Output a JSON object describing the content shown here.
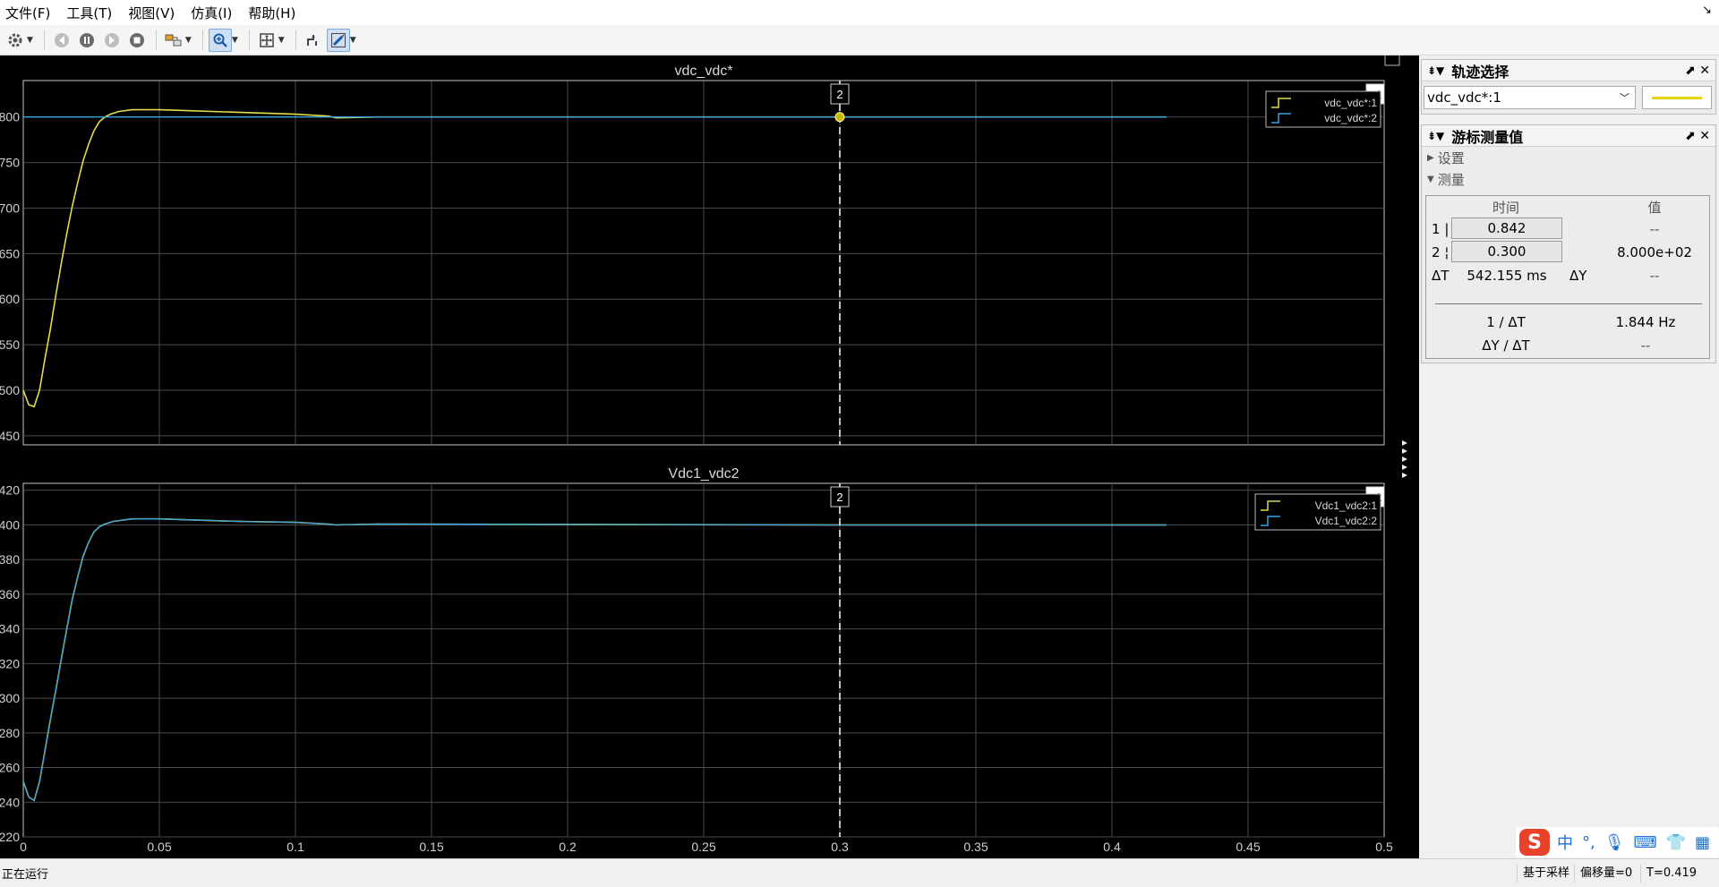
{
  "menu": [
    "文件(F)",
    "工具(T)",
    "视图(V)",
    "仿真(I)",
    "帮助(H)"
  ],
  "window_corner_icon": "↘",
  "plots": [
    {
      "title": "vdc_vdc*",
      "legend": [
        "vdc_vdc*:1",
        "vdc_vdc*:2"
      ],
      "yticks": [
        "800",
        "750",
        "700",
        "650",
        "600",
        "550",
        "500",
        "450"
      ],
      "cursor_tag": "2",
      "corner_tag": "1"
    },
    {
      "title": "Vdc1_vdc2",
      "legend": [
        "Vdc1_vdc2:1",
        "Vdc1_vdc2:2"
      ],
      "yticks": [
        "420",
        "400",
        "380",
        "360",
        "340",
        "320",
        "300",
        "280",
        "260",
        "240",
        "220"
      ],
      "cursor_tag": "2",
      "corner_tag": "1"
    }
  ],
  "xticks": [
    "0",
    "0.05",
    "0.1",
    "0.15",
    "0.2",
    "0.25",
    "0.3",
    "0.35",
    "0.4",
    "0.45",
    "0.5"
  ],
  "colors": {
    "series1": "#e3dc4a",
    "series2": "#3aa0e0",
    "grid": "#4a4a4a",
    "axis": "#c8c8c8",
    "cursor": "#ffffff"
  },
  "chart_data": [
    {
      "type": "line",
      "title": "vdc_vdc*",
      "xlim": [
        0,
        0.5
      ],
      "ylim": [
        440,
        840
      ],
      "series": [
        {
          "name": "vdc_vdc*:1",
          "color": "#e3dc4a",
          "x": [
            0,
            0.002,
            0.004,
            0.006,
            0.008,
            0.01,
            0.012,
            0.014,
            0.016,
            0.018,
            0.02,
            0.022,
            0.024,
            0.026,
            0.028,
            0.03,
            0.032,
            0.035,
            0.04,
            0.05,
            0.06,
            0.08,
            0.1,
            0.112,
            0.115,
            0.13,
            0.2,
            0.3,
            0.42
          ],
          "y": [
            500,
            484,
            482,
            500,
            535,
            568,
            605,
            640,
            672,
            702,
            728,
            752,
            770,
            785,
            795,
            800,
            803,
            806,
            808,
            808,
            807,
            805,
            803,
            801,
            799,
            800,
            800,
            800,
            800
          ]
        },
        {
          "name": "vdc_vdc*:2",
          "color": "#3aa0e0",
          "x": [
            0,
            0.42
          ],
          "y": [
            800,
            800
          ]
        }
      ],
      "cursors": [
        {
          "label": "2",
          "x": 0.3,
          "y": 800
        }
      ]
    },
    {
      "type": "line",
      "title": "Vdc1_vdc2",
      "xlim": [
        0,
        0.5
      ],
      "ylim": [
        220,
        424
      ],
      "series": [
        {
          "name": "Vdc1_vdc2:1",
          "color": "#e3dc4a",
          "x": [
            0,
            0.002,
            0.004,
            0.006,
            0.008,
            0.01,
            0.012,
            0.014,
            0.016,
            0.018,
            0.02,
            0.022,
            0.024,
            0.026,
            0.028,
            0.03,
            0.033,
            0.04,
            0.05,
            0.06,
            0.08,
            0.1,
            0.112,
            0.115,
            0.13,
            0.2,
            0.3,
            0.42
          ],
          "y": [
            252,
            243,
            241,
            252,
            270,
            288,
            305,
            323,
            340,
            357,
            370,
            382,
            390,
            396,
            399,
            400.5,
            402,
            403.5,
            403.5,
            403,
            402,
            401.5,
            400.5,
            400,
            400.5,
            400.3,
            400,
            400
          ]
        },
        {
          "name": "Vdc1_vdc2:2",
          "color": "#3aa0e0",
          "x": [
            0,
            0.002,
            0.004,
            0.006,
            0.008,
            0.01,
            0.012,
            0.014,
            0.016,
            0.018,
            0.02,
            0.022,
            0.024,
            0.026,
            0.028,
            0.03,
            0.033,
            0.04,
            0.05,
            0.06,
            0.08,
            0.1,
            0.112,
            0.115,
            0.13,
            0.2,
            0.3,
            0.42
          ],
          "y": [
            252,
            243,
            241,
            252,
            270,
            288,
            305,
            323,
            340,
            357,
            370,
            382,
            390,
            396,
            399,
            400.5,
            402,
            403.5,
            403.5,
            403,
            402,
            401.5,
            400.5,
            400,
            400.5,
            400.3,
            400,
            400
          ]
        }
      ],
      "cursors": [
        {
          "label": "2",
          "x": 0.3
        }
      ]
    }
  ],
  "trace_panel": {
    "title": "轨迹选择",
    "selected": "vdc_vdc*:1",
    "line_color": "#e8d400"
  },
  "cursor_panel": {
    "title": "游标测量值",
    "settings_label": "设置",
    "measure_label": "测量",
    "col_time": "时间",
    "col_value": "值",
    "rows": [
      {
        "id": "1",
        "time": "0.842",
        "value": "--"
      },
      {
        "id": "2",
        "time": "0.300",
        "value": "8.000e+02"
      }
    ],
    "dt_label": "ΔT",
    "dt_value": "542.155 ms",
    "dy_label": "ΔY",
    "dy_value": "--",
    "inv_dt_label": "1 / ΔT",
    "inv_dt_value": "1.844 Hz",
    "dydt_label": "ΔY / ΔT",
    "dydt_value": "--"
  },
  "status": {
    "running": "正在运行",
    "sample_based": "基于采样",
    "offset": "偏移量=0",
    "time": "T=0.419"
  },
  "ime": {
    "logo": "S",
    "chinese": "中"
  }
}
